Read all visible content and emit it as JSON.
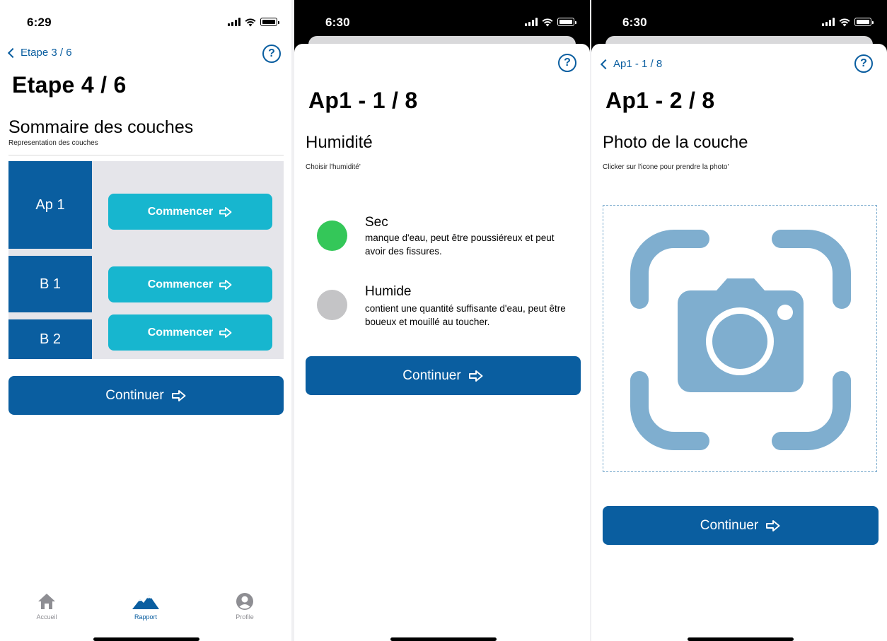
{
  "colors": {
    "brand_blue": "#0a5ea0",
    "cyan": "#17b6cf",
    "green_dot": "#34c759",
    "gray_dot": "#c4c4c6",
    "camera_blue": "#7faecf"
  },
  "screen1": {
    "time": "6:29",
    "back_label": "Etape 3 / 6",
    "help_icon": "?",
    "title": "Etape 4 / 6",
    "section_title": "Sommaire des couches",
    "section_subtitle": "Representation des couches",
    "layers": [
      {
        "label": "Ap 1",
        "button": "Commencer"
      },
      {
        "label": "B 1",
        "button": "Commencer"
      },
      {
        "label": "B 2",
        "button": "Commencer"
      }
    ],
    "continue_label": "Continuer",
    "tabs": [
      {
        "label": "Accueil",
        "icon": "home-icon"
      },
      {
        "label": "Rapport",
        "icon": "mountain-icon"
      },
      {
        "label": "Profile",
        "icon": "profile-icon"
      }
    ]
  },
  "screen2": {
    "time": "6:30",
    "help_icon": "?",
    "title": "Ap1 - 1 / 8",
    "section_title": "Humidité",
    "section_subtitle": "Choisir l'humidité'",
    "options": [
      {
        "name": "Sec",
        "description": "manque d'eau, peut être poussiéreux et peut avoir des fissures."
      },
      {
        "name": "Humide",
        "description": "contient une quantité suffisante d'eau, peut être boueux et mouillé au toucher."
      }
    ],
    "continue_label": "Continuer"
  },
  "screen3": {
    "time": "6:30",
    "back_label": "Ap1 - 1 / 8",
    "help_icon": "?",
    "title": "Ap1 - 2 / 8",
    "section_title": "Photo de la couche",
    "section_subtitle": "Clicker sur l'icone pour prendre la photo'",
    "camera_icon": "camera-viewfinder-icon",
    "continue_label": "Continuer"
  }
}
